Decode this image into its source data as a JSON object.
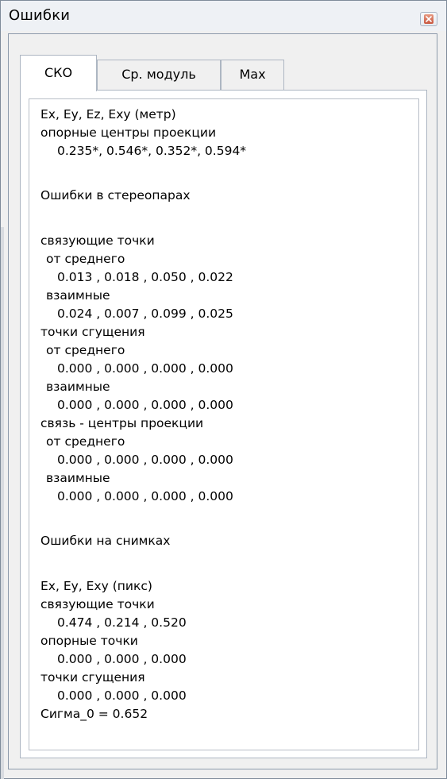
{
  "window": {
    "title": "Ошибки"
  },
  "tabs": [
    {
      "label": "СКО",
      "active": true
    },
    {
      "label": "Ср. модуль",
      "active": false
    },
    {
      "label": "Max",
      "active": false
    }
  ],
  "content": {
    "lines": [
      "Ex, Ey, Ez, Exy (метр)",
      "опорные центры проекции",
      "0.235*, 0.546*, 0.352*, 0.594*",
      "",
      "Ошибки в стереопарах",
      "",
      "связующие точки",
      "от среднего",
      "0.013 , 0.018 , 0.050 , 0.022",
      "взаимные",
      "0.024 , 0.007 , 0.099 , 0.025",
      "точки сгущения",
      "от среднего",
      "0.000 , 0.000 , 0.000 , 0.000",
      "взаимные",
      "0.000 , 0.000 , 0.000 , 0.000",
      "связь - центры проекции",
      "от среднего",
      "0.000 , 0.000 , 0.000 , 0.000",
      "взаимные",
      "0.000 , 0.000 , 0.000 , 0.000",
      "",
      "Ошибки на снимках",
      "",
      "Ex, Ey, Exy (пикс)",
      "связующие точки",
      "0.474 , 0.214 , 0.520",
      "опорные точки",
      "0.000 , 0.000 , 0.000",
      "точки сгущения",
      "0.000 , 0.000 , 0.000",
      "Сигма_0 = 0.652"
    ]
  }
}
